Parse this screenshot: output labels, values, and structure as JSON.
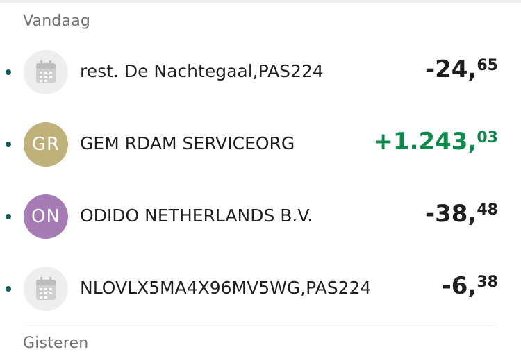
{
  "sections": {
    "today": "Vandaag",
    "yesterday": "Gisteren"
  },
  "transactions": [
    {
      "name": "rest. De Nachtegaal,PAS224",
      "avatar": "calendar-icon",
      "amount_main": "-24,",
      "amount_cents": "65",
      "sign": "negative"
    },
    {
      "name": "GEM RDAM SERVICEORG",
      "avatar_initials": "GR",
      "avatar_color": "#bfb17a",
      "amount_main": "+1.243,",
      "amount_cents": "03",
      "sign": "positive"
    },
    {
      "name": "ODIDO NETHERLANDS B.V.",
      "avatar_initials": "ON",
      "avatar_color": "#a57ab5",
      "amount_main": "-38,",
      "amount_cents": "48",
      "sign": "negative"
    },
    {
      "name": "NLOVLX5MA4X96MV5WG,PAS224",
      "avatar": "calendar-icon",
      "amount_main": "-6,",
      "amount_cents": "38",
      "sign": "negative"
    }
  ],
  "colors": {
    "positive": "#0f8a4d",
    "dot": "#1b5d57"
  }
}
